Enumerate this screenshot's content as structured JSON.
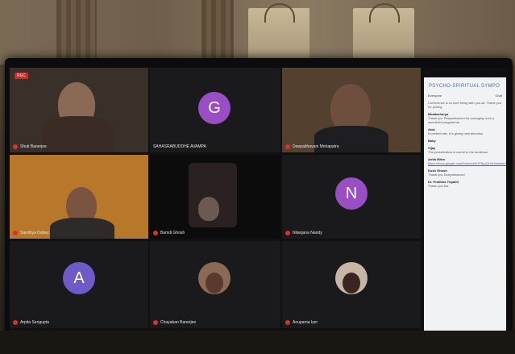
{
  "recording": {
    "label": "REC"
  },
  "participants": [
    {
      "name": "Shuti Banerjee"
    },
    {
      "name": "SAHASRABUDDHE AVAMPA"
    },
    {
      "name": "Deepabhavani Mohapatra"
    },
    {
      "name": "Sandhya Dubey"
    },
    {
      "name": "Bamdi Ghosh"
    },
    {
      "name": "Nilanjana Nandy"
    },
    {
      "name": "Arpita Sengupta"
    },
    {
      "name": "Chayaban Banerjee"
    },
    {
      "name": "Anupama Iyer"
    }
  ],
  "avatars": {
    "g": "G",
    "n": "N",
    "a": "A"
  },
  "chat": {
    "title": "PSYCHO-SPIRITUAL SYMPO",
    "header_from": "Everyone",
    "header_to": "Chat",
    "messages": [
      {
        "from": "",
        "text": "Conference is so nice being with you all. Thank you for joining."
      },
      {
        "from": "Bhattacharya",
        "text": "Thank you Deepabhavani for arranging such a wonderful programme."
      },
      {
        "from": "Alok",
        "text": "Excellent talk, it is giving new direction."
      },
      {
        "from": "Baby",
        "text": ""
      },
      {
        "from": "Vijay",
        "text": "The presentation is useful to the audience."
      },
      {
        "from": "Anita Mitra",
        "text": "https://docs.google.com/forms/d/e/1FAIpQLSe/viewform"
      },
      {
        "from": "Kush Ghosh",
        "text": "Thank you Deepabhavani"
      },
      {
        "from": "Dr. Pratibha Tripathi",
        "text": "Thank you Ma"
      }
    ]
  }
}
